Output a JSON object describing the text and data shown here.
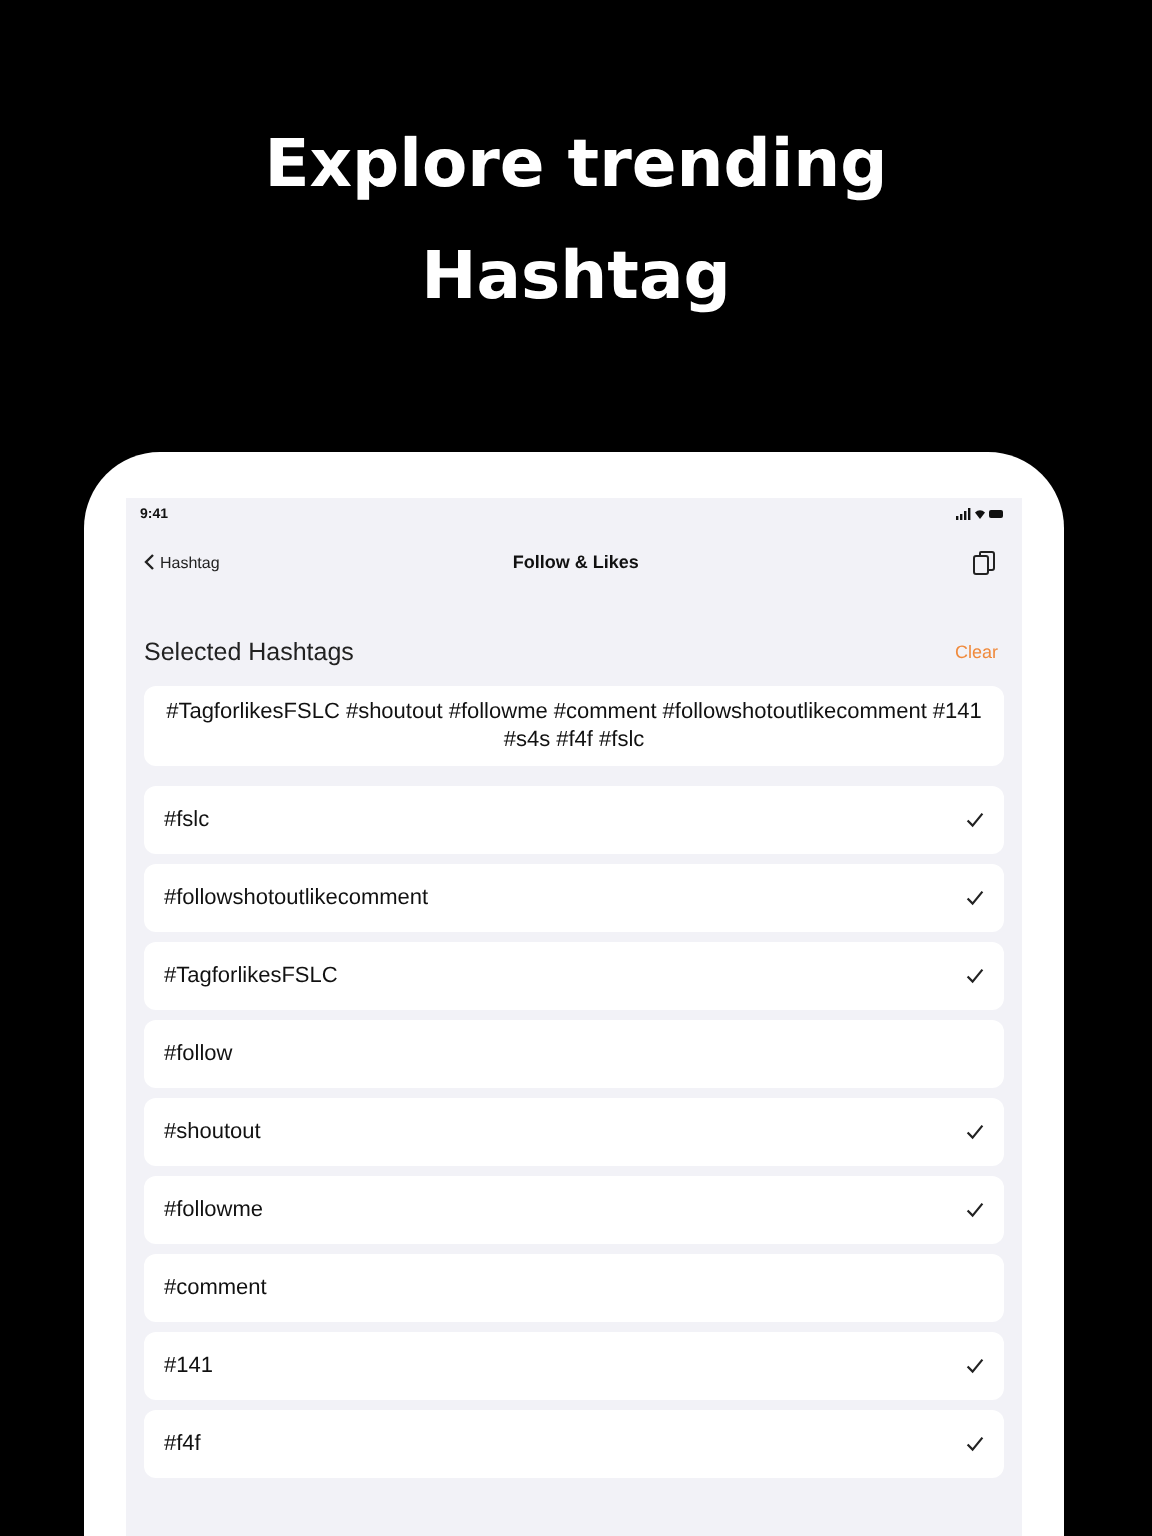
{
  "headline": "Explore trending Hashtag",
  "status_bar": {
    "time": "9:41"
  },
  "nav": {
    "back": "Hashtag",
    "title": "Follow & Likes"
  },
  "section": {
    "title": "Selected Hashtags",
    "action": "Clear"
  },
  "selected_text": "#TagforlikesFSLC #shoutout #followme #comment #followshotoutlikecomment #141 #s4s #f4f #fslc",
  "hashtags": [
    {
      "label": "#fslc",
      "checked": true
    },
    {
      "label": "#followshotoutlikecomment",
      "checked": true
    },
    {
      "label": "#TagforlikesFSLC",
      "checked": true
    },
    {
      "label": "#follow",
      "checked": false
    },
    {
      "label": "#shoutout",
      "checked": true
    },
    {
      "label": "#followme",
      "checked": true
    },
    {
      "label": "#comment",
      "checked": false
    },
    {
      "label": "#141",
      "checked": true
    },
    {
      "label": "#f4f",
      "checked": true
    }
  ]
}
